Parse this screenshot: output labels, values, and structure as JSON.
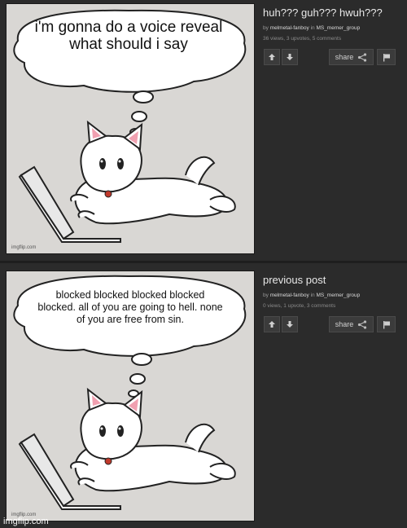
{
  "posts": [
    {
      "bubble_text": "i'm gonna do a voice reveal what should i say",
      "image_credit": "imgflip.com",
      "title": "huh??? guh??? hwuh???",
      "byline_prefix": "by",
      "author": "melmetal-fanboy",
      "in_label": "in",
      "stream": "MS_memer_group",
      "stats": "36 views, 3 upvotes, 5 comments",
      "share_label": "share"
    },
    {
      "bubble_text": "blocked blocked blocked blocked blocked. all of you are going to hell. none of you are free from sin.",
      "image_credit": "imgflip.com",
      "title": "previous post",
      "byline_prefix": "by",
      "author": "melmetal-fanboy",
      "in_label": "in",
      "stream": "MS_memer_group",
      "stats": "0 views, 1 upvote, 3 comments",
      "share_label": "share"
    }
  ],
  "watermark": "imgflip.com",
  "icons": {
    "upvote": "up-arrow-icon",
    "downvote": "down-arrow-icon",
    "share": "share-icon",
    "flag": "flag-icon"
  },
  "colors": {
    "page_bg": "#2b2b2b",
    "image_bg": "#d9d7d4",
    "title": "#e8e8e8",
    "link": "#d8d8d8"
  }
}
